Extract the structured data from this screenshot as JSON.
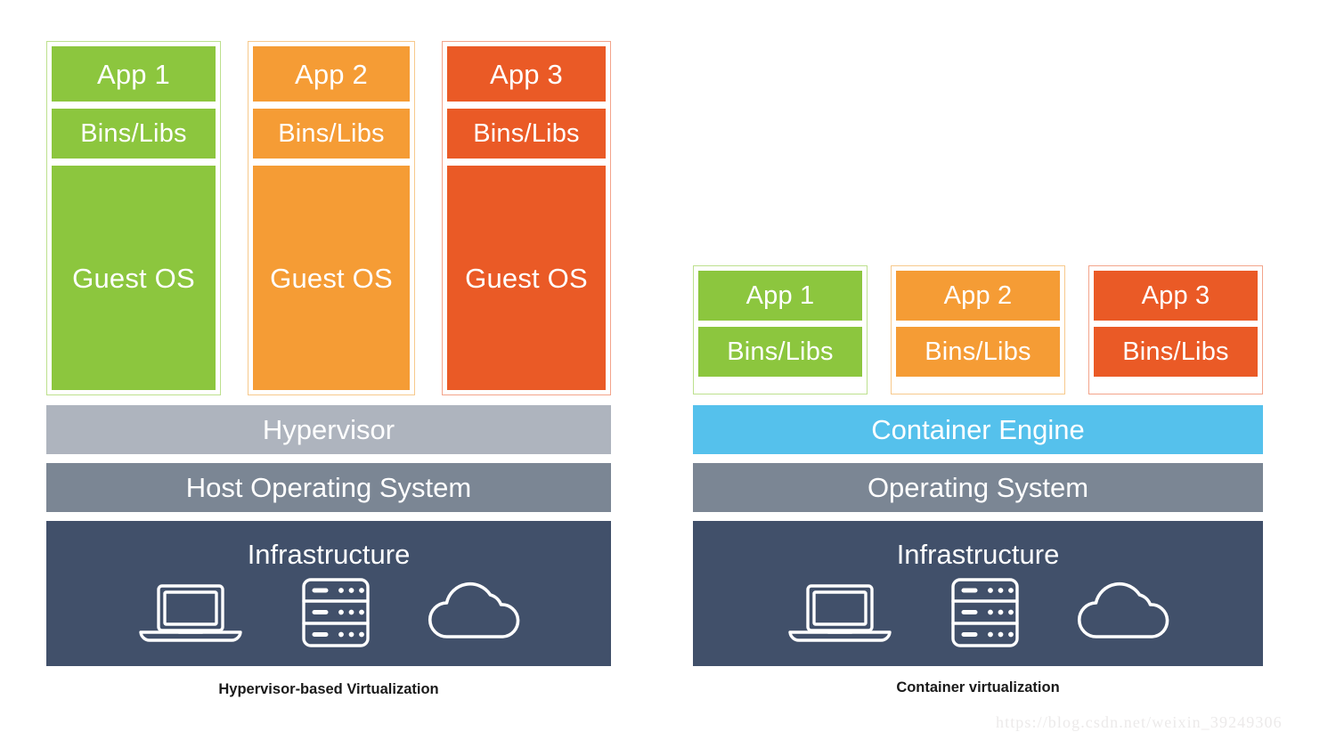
{
  "diagram": {
    "title": "Hypervisor-based Virtualization vs Container virtualization",
    "colors": {
      "green": "#8cc63e",
      "orange": "#f59c35",
      "red": "#ea5a26",
      "blue": "#55c1ec",
      "hypervisor_gray": "#aeb4be",
      "os_gray": "#7b8694",
      "infrastructure_navy": "#41506a",
      "background": "#ffffff"
    }
  },
  "left_panel": {
    "caption": "Hypervisor-based Virtualization",
    "columns": [
      {
        "color": "green",
        "app": "App 1",
        "bins": "Bins/Libs",
        "guest": "Guest OS"
      },
      {
        "color": "orange",
        "app": "App 2",
        "bins": "Bins/Libs",
        "guest": "Guest OS"
      },
      {
        "color": "red",
        "app": "App 3",
        "bins": "Bins/Libs",
        "guest": "Guest OS"
      }
    ],
    "hypervisor_label": "Hypervisor",
    "os_label": "Host Operating System",
    "infrastructure_label": "Infrastructure",
    "infrastructure_icons": [
      "laptop-icon",
      "server-rack-icon",
      "cloud-icon"
    ]
  },
  "right_panel": {
    "caption": "Container virtualization",
    "columns": [
      {
        "color": "green",
        "app": "App 1",
        "bins": "Bins/Libs"
      },
      {
        "color": "orange",
        "app": "App 2",
        "bins": "Bins/Libs"
      },
      {
        "color": "red",
        "app": "App 3",
        "bins": "Bins/Libs"
      }
    ],
    "engine_label": "Container Engine",
    "os_label": "Operating System",
    "infrastructure_label": "Infrastructure",
    "infrastructure_icons": [
      "laptop-icon",
      "server-rack-icon",
      "cloud-icon"
    ]
  },
  "watermark": {
    "text": "https://blog.csdn.net/weixin_39249306"
  }
}
